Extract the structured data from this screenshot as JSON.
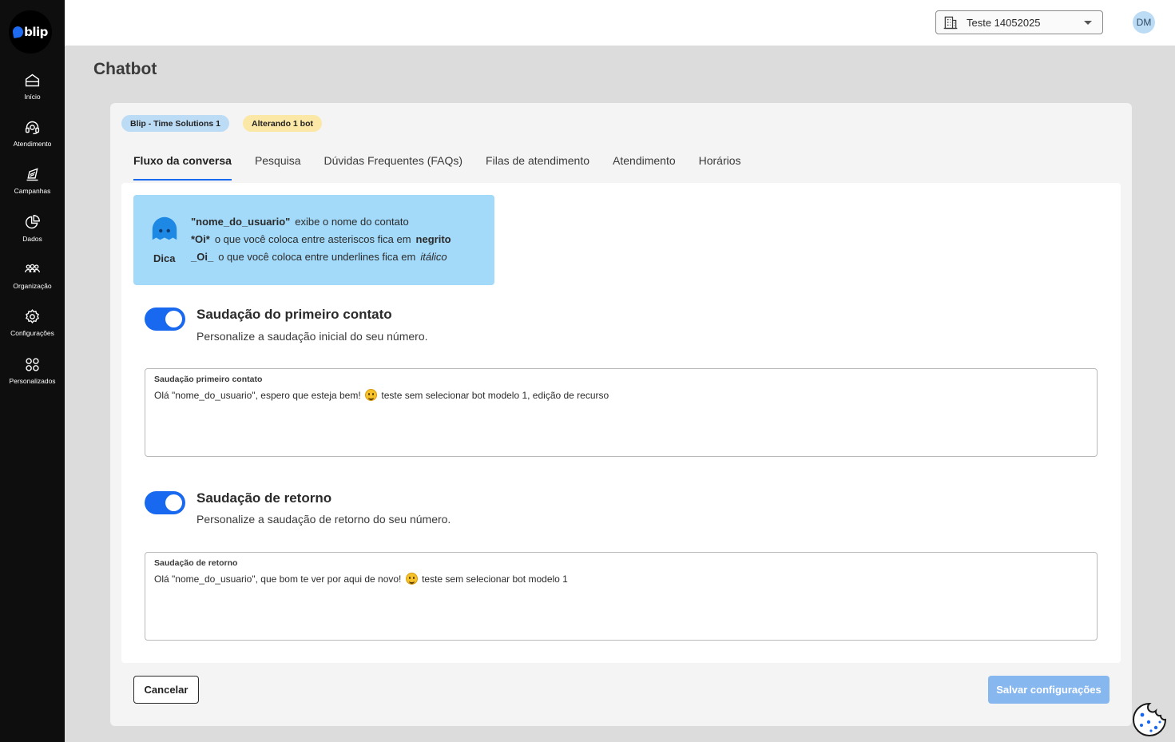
{
  "sidebar": {
    "logo_text": "blip",
    "items": [
      {
        "label": "Início",
        "icon": "home-icon"
      },
      {
        "label": "Atendimento",
        "icon": "headset-icon"
      },
      {
        "label": "Campanhas",
        "icon": "megaphone-icon"
      },
      {
        "label": "Dados",
        "icon": "pie-chart-icon"
      },
      {
        "label": "Organização",
        "icon": "group-icon"
      },
      {
        "label": "Configurações",
        "icon": "gear-icon"
      },
      {
        "label": "Personalizados",
        "icon": "grid-icon"
      }
    ]
  },
  "header": {
    "tenant": "Teste 14052025",
    "avatar_initials": "DM"
  },
  "page": {
    "title": "Chatbot"
  },
  "badges": {
    "bot_name": "Blip - Time Solutions 1",
    "status": "Alterando 1 bot"
  },
  "tabs": [
    {
      "label": "Fluxo da conversa",
      "active": true
    },
    {
      "label": "Pesquisa"
    },
    {
      "label": "Dúvidas Frequentes (FAQs)"
    },
    {
      "label": "Filas de atendimento"
    },
    {
      "label": "Atendimento"
    },
    {
      "label": "Horários"
    }
  ],
  "tip": {
    "label": "Dica",
    "line1_key": "\"nome_do_usuario\"",
    "line1_text": "exibe o nome do contato",
    "line2_key": "*Oi*",
    "line2_text": "o que você coloca entre asteriscos fica em",
    "line2_emph": "negrito",
    "line3_key": "_Oi_",
    "line3_text": "o que você coloca entre underlines fica em",
    "line3_emph": "itálico"
  },
  "first_greeting": {
    "enabled": true,
    "title": "Saudação do primeiro contato",
    "subtitle": "Personalize a saudação inicial do seu número.",
    "field_label": "Saudação primeiro contato",
    "value_before_emoji": "Olá \"nome_do_usuario\", espero que esteja bem!",
    "emoji": "grinning-face-emoji",
    "value_after_emoji": "teste sem selecionar bot modelo 1, edição de recurso"
  },
  "return_greeting": {
    "enabled": true,
    "title": "Saudação de retorno",
    "subtitle": "Personalize a saudação de retorno do seu número.",
    "field_label": "Saudação de retorno",
    "value_before_emoji": "Olá \"nome_do_usuario\", que bom te ver por aqui de novo!",
    "emoji": "smiling-face-emoji",
    "value_after_emoji": "teste sem selecionar bot modelo 1"
  },
  "actions": {
    "cancel": "Cancelar",
    "save": "Salvar configurações"
  },
  "colors": {
    "accent": "#1968f0",
    "tip_bg": "#a3d9f9",
    "save_disabled": "#87b7ef"
  }
}
